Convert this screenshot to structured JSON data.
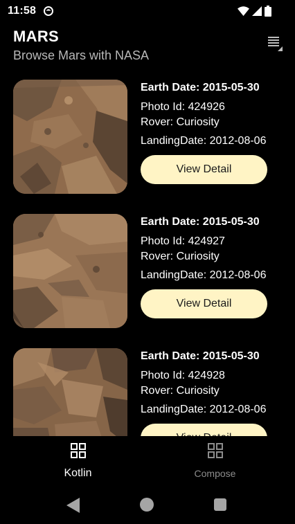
{
  "status_bar": {
    "time": "11:58"
  },
  "app_bar": {
    "title": "MARS",
    "subtitle": "Browse Mars with NASA"
  },
  "photos": [
    {
      "earth_date": "Earth Date: 2015-05-30",
      "photo_id": "Photo Id: 424926",
      "rover": "Rover: Curiosity",
      "landing_date": "LandingDate: 2012-08-06",
      "button_label": "View Detail"
    },
    {
      "earth_date": "Earth Date: 2015-05-30",
      "photo_id": "Photo Id: 424927",
      "rover": "Rover: Curiosity",
      "landing_date": "LandingDate: 2012-08-06",
      "button_label": "View Detail"
    },
    {
      "earth_date": "Earth Date: 2015-05-30",
      "photo_id": "Photo Id: 424928",
      "rover": "Rover: Curiosity",
      "landing_date": "LandingDate: 2012-08-06",
      "button_label": "View Detail"
    }
  ],
  "bottom_nav": {
    "items": [
      {
        "label": "Kotlin",
        "icon": "grid-icon",
        "selected": true
      },
      {
        "label": "Compose",
        "icon": "grid-icon",
        "selected": false
      }
    ]
  },
  "colors": {
    "background": "#000000",
    "button": "#fff4c5",
    "subtitle": "#b9b9b9",
    "nav_inactive": "#8c8c8c"
  }
}
